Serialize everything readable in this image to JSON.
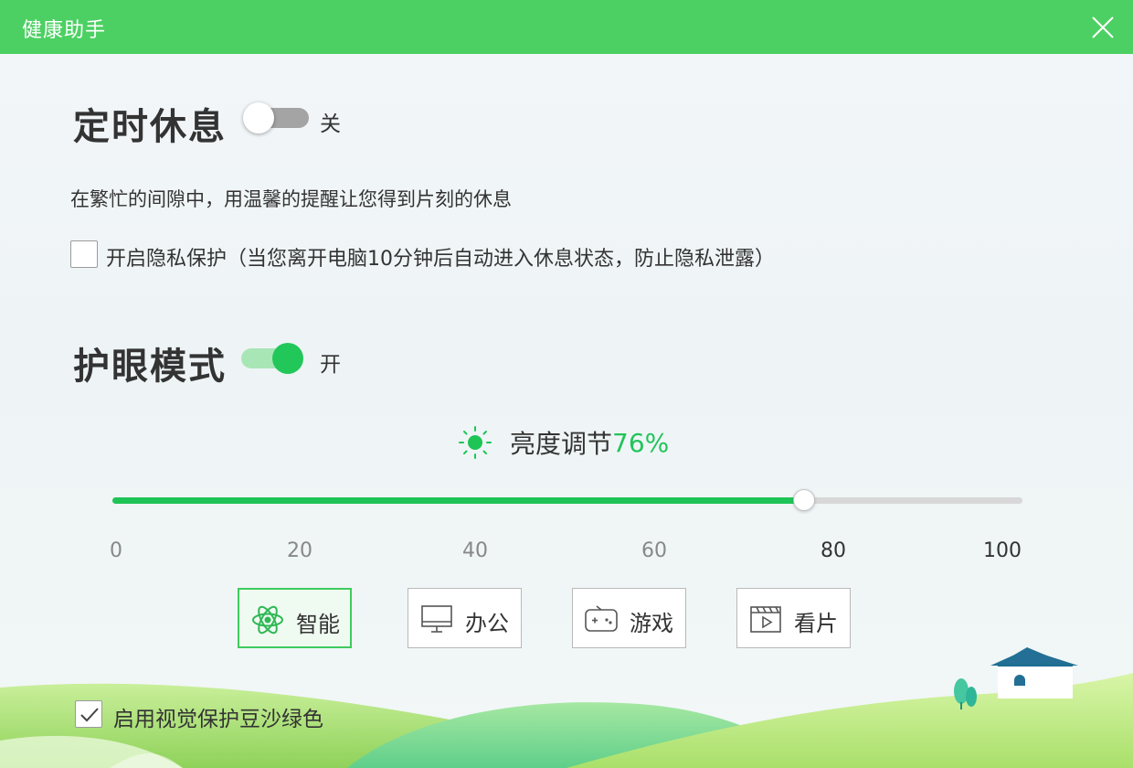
{
  "window": {
    "title": "健康助手"
  },
  "timed_rest": {
    "title": "定时休息",
    "switch_state": "关",
    "description": "在繁忙的间隙中，用温馨的提醒让您得到片刻的休息",
    "privacy_label": "开启隐私保护（当您离开电脑10分钟后自动进入休息状态，防止隐私泄露）"
  },
  "eye_care": {
    "title": "护眼模式",
    "switch_state": "开",
    "brightness_label": "亮度调节",
    "brightness_value": "76%",
    "slider": {
      "min": 0,
      "max": 100,
      "value": 76,
      "ticks": [
        "0",
        "20",
        "40",
        "60",
        "80",
        "100"
      ]
    },
    "modes": [
      {
        "label": "智能",
        "icon": "atom-icon"
      },
      {
        "label": "办公",
        "icon": "monitor-icon"
      },
      {
        "label": "游戏",
        "icon": "gamepad-icon"
      },
      {
        "label": "看片",
        "icon": "film-icon"
      }
    ],
    "green_bg_label": "启用视觉保护豆沙绿色"
  },
  "colors": {
    "titlebar": "#4cd063",
    "accent": "#1fc457",
    "switch_on": "#22c75a"
  }
}
